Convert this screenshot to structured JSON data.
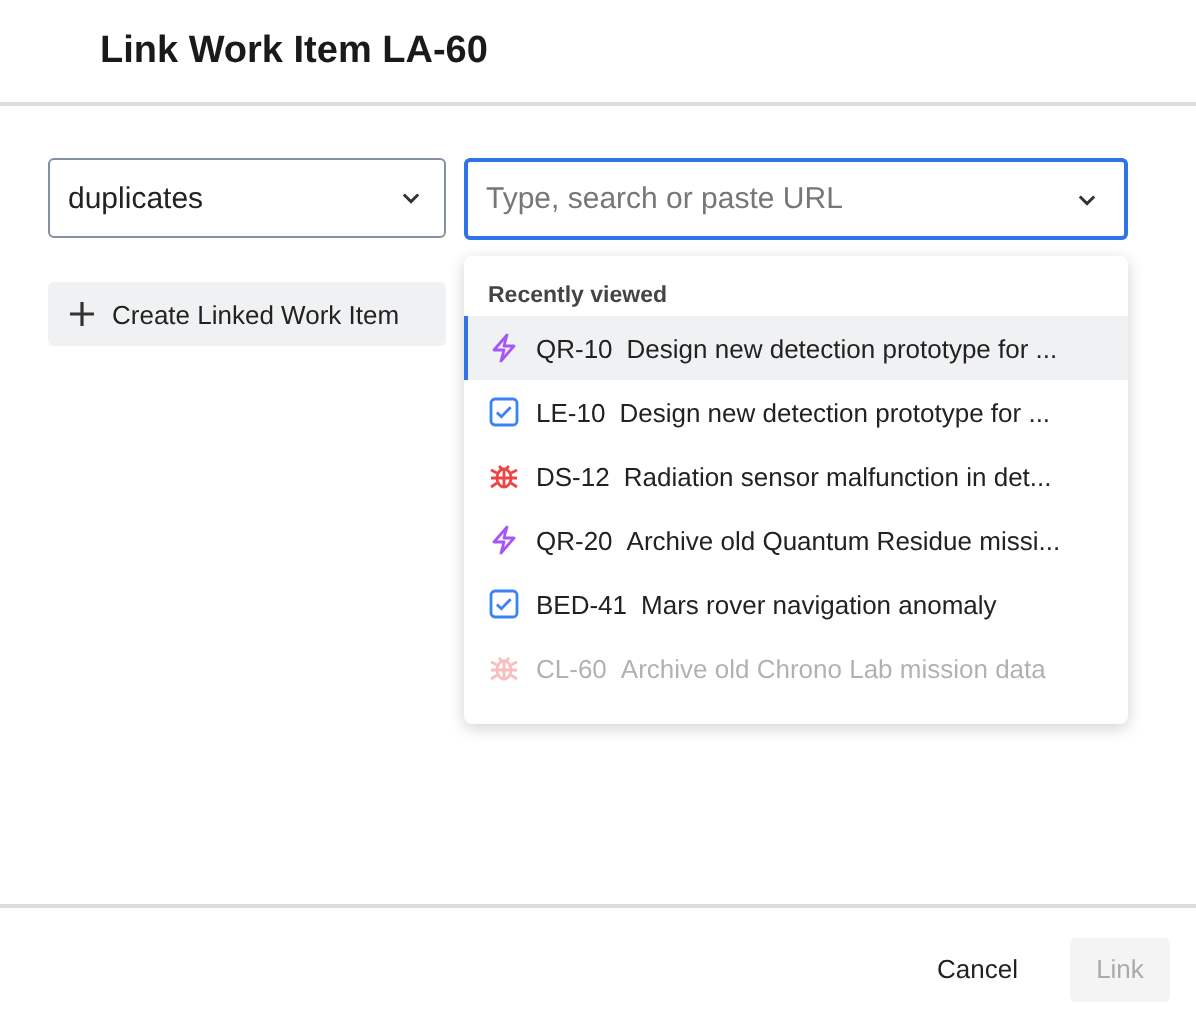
{
  "dialog": {
    "title": "Link Work Item LA-60"
  },
  "link_type": {
    "value": "duplicates"
  },
  "search": {
    "placeholder": "Type, search or paste URL",
    "focused": true
  },
  "create_button": {
    "label": "Create Linked Work Item"
  },
  "dropdown": {
    "heading": "Recently viewed",
    "items": [
      {
        "kind": "story",
        "key": "QR-10",
        "summary": "Design new detection prototype for ...",
        "selected": true,
        "disabled": false
      },
      {
        "kind": "task",
        "key": "LE-10",
        "summary": "Design new detection prototype for ...",
        "selected": false,
        "disabled": false
      },
      {
        "kind": "bug",
        "key": "DS-12",
        "summary": "Radiation sensor malfunction in det...",
        "selected": false,
        "disabled": false
      },
      {
        "kind": "story",
        "key": "QR-20",
        "summary": "Archive old Quantum Residue missi...",
        "selected": false,
        "disabled": false
      },
      {
        "kind": "task",
        "key": "BED-41",
        "summary": "Mars rover navigation anomaly",
        "selected": false,
        "disabled": false
      },
      {
        "kind": "bug",
        "key": "CL-60",
        "summary": "Archive old Chrono Lab mission data",
        "selected": false,
        "disabled": true
      }
    ]
  },
  "footer": {
    "cancel": "Cancel",
    "link": {
      "label": "Link",
      "disabled": true
    }
  }
}
